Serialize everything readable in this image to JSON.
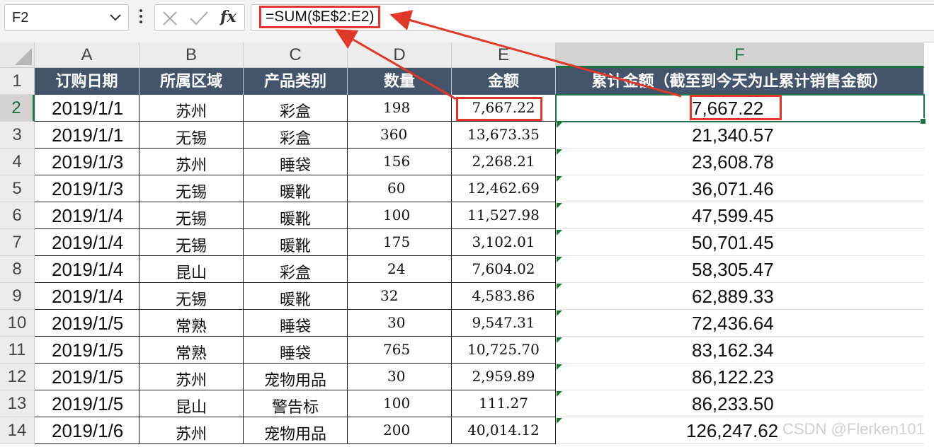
{
  "name_box": {
    "value": "F2"
  },
  "formula_bar": {
    "fx_label": "fx",
    "formula": "=SUM($E$2:E2)"
  },
  "columns": [
    "A",
    "B",
    "C",
    "D",
    "E",
    "F"
  ],
  "header_row": {
    "row_number": "1",
    "cells": [
      "订购日期",
      "所属区域",
      "产品类别",
      "数量",
      "金额",
      "累计金额（截至到今天为止累计销售金额）"
    ]
  },
  "rows": [
    {
      "num": "2",
      "date": "2019/1/1",
      "region": "苏州",
      "category": "彩盒",
      "qty": "198",
      "amount": "7,667.22",
      "cumulative": "7,667.22"
    },
    {
      "num": "3",
      "date": "2019/1/1",
      "region": "无锡",
      "category": "彩盒",
      "qty": "360",
      "amount": "13,673.35",
      "cumulative": "21,340.57"
    },
    {
      "num": "4",
      "date": "2019/1/3",
      "region": "苏州",
      "category": "睡袋",
      "qty": "156",
      "amount": "2,268.21",
      "cumulative": "23,608.78"
    },
    {
      "num": "5",
      "date": "2019/1/3",
      "region": "无锡",
      "category": "暖靴",
      "qty": "60",
      "amount": "12,462.69",
      "cumulative": "36,071.46"
    },
    {
      "num": "6",
      "date": "2019/1/4",
      "region": "无锡",
      "category": "暖靴",
      "qty": "100",
      "amount": "11,527.98",
      "cumulative": "47,599.45"
    },
    {
      "num": "7",
      "date": "2019/1/4",
      "region": "无锡",
      "category": "暖靴",
      "qty": "175",
      "amount": "3,102.01",
      "cumulative": "50,701.45"
    },
    {
      "num": "8",
      "date": "2019/1/4",
      "region": "昆山",
      "category": "彩盒",
      "qty": "24",
      "amount": "7,604.02",
      "cumulative": "58,305.47"
    },
    {
      "num": "9",
      "date": "2019/1/4",
      "region": "无锡",
      "category": "暖靴",
      "qty": "32",
      "amount": "4,583.86",
      "cumulative": "62,889.33"
    },
    {
      "num": "10",
      "date": "2019/1/5",
      "region": "常熟",
      "category": "睡袋",
      "qty": "30",
      "amount": "9,547.31",
      "cumulative": "72,436.64"
    },
    {
      "num": "11",
      "date": "2019/1/5",
      "region": "常熟",
      "category": "睡袋",
      "qty": "765",
      "amount": "10,725.70",
      "cumulative": "83,162.34"
    },
    {
      "num": "12",
      "date": "2019/1/5",
      "region": "苏州",
      "category": "宠物用品",
      "qty": "30",
      "amount": "2,959.89",
      "cumulative": "86,122.23"
    },
    {
      "num": "13",
      "date": "2019/1/5",
      "region": "昆山",
      "category": "警告标",
      "qty": "100",
      "amount": "111.27",
      "cumulative": "86,233.50"
    },
    {
      "num": "14",
      "date": "2019/1/6",
      "region": "苏州",
      "category": "宠物用品",
      "qty": "200",
      "amount": "40,014.12",
      "cumulative": "126,247.62"
    }
  ],
  "watermark": "CSDN @Flerken101",
  "colors": {
    "header_bg": "#44546a",
    "selection": "#1d7145",
    "annotation_red": "#e0382b",
    "error_triangle": "#1a7a2b"
  }
}
